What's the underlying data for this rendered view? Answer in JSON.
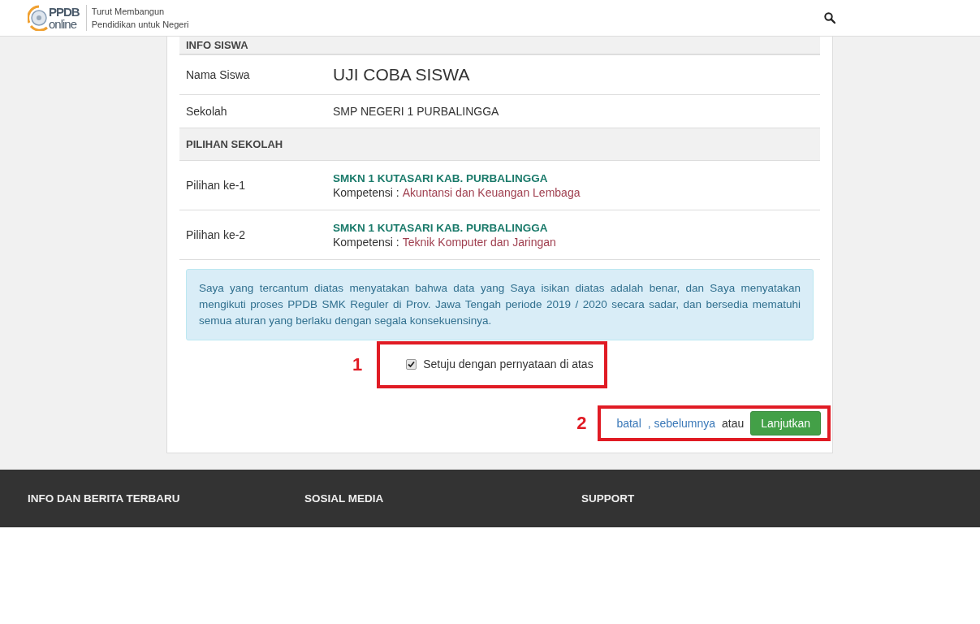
{
  "header": {
    "logo_top": "PPDB",
    "logo_bottom": "online",
    "tagline": [
      "Turut Membangun",
      "Pendidikan untuk Negeri"
    ]
  },
  "info_siswa": {
    "title": "INFO SISWA",
    "rows": [
      {
        "label": "Nama Siswa",
        "value": "UJI COBA SISWA",
        "kind": "name"
      },
      {
        "label": "Sekolah",
        "value": "SMP NEGERI 1 PURBALINGGA",
        "kind": "text"
      }
    ]
  },
  "pilihan_sekolah": {
    "title": "PILIHAN SEKOLAH",
    "rows": [
      {
        "label": "Pilihan ke-1",
        "school": "SMKN 1 KUTASARI KAB. PURBALINGGA",
        "competence_label": "Kompetensi :",
        "competence": "Akuntansi dan Keuangan Lembaga"
      },
      {
        "label": "Pilihan ke-2",
        "school": "SMKN 1 KUTASARI KAB. PURBALINGGA",
        "competence_label": "Kompetensi :",
        "competence": "Teknik Komputer dan Jaringan"
      }
    ]
  },
  "statement": "Saya yang tercantum diatas menyatakan bahwa data yang Saya isikan diatas adalah benar, dan Saya menyatakan mengikuti proses PPDB SMK Reguler di Prov. Jawa Tengah periode 2019 / 2020 secara sadar, dan bersedia mematuhi semua aturan yang berlaku dengan segala konsekuensinya.",
  "agree": {
    "label": "Setuju dengan pernyataan di atas",
    "checked": true,
    "marker": "1"
  },
  "actions": {
    "marker": "2",
    "cancel": "batal",
    "previous": ", sebelumnya",
    "or": "atau",
    "next": "Lanjutkan"
  },
  "footer": {
    "columns": [
      "INFO DAN BERITA TERBARU",
      "SOSIAL MEDIA",
      "SUPPORT"
    ]
  }
}
